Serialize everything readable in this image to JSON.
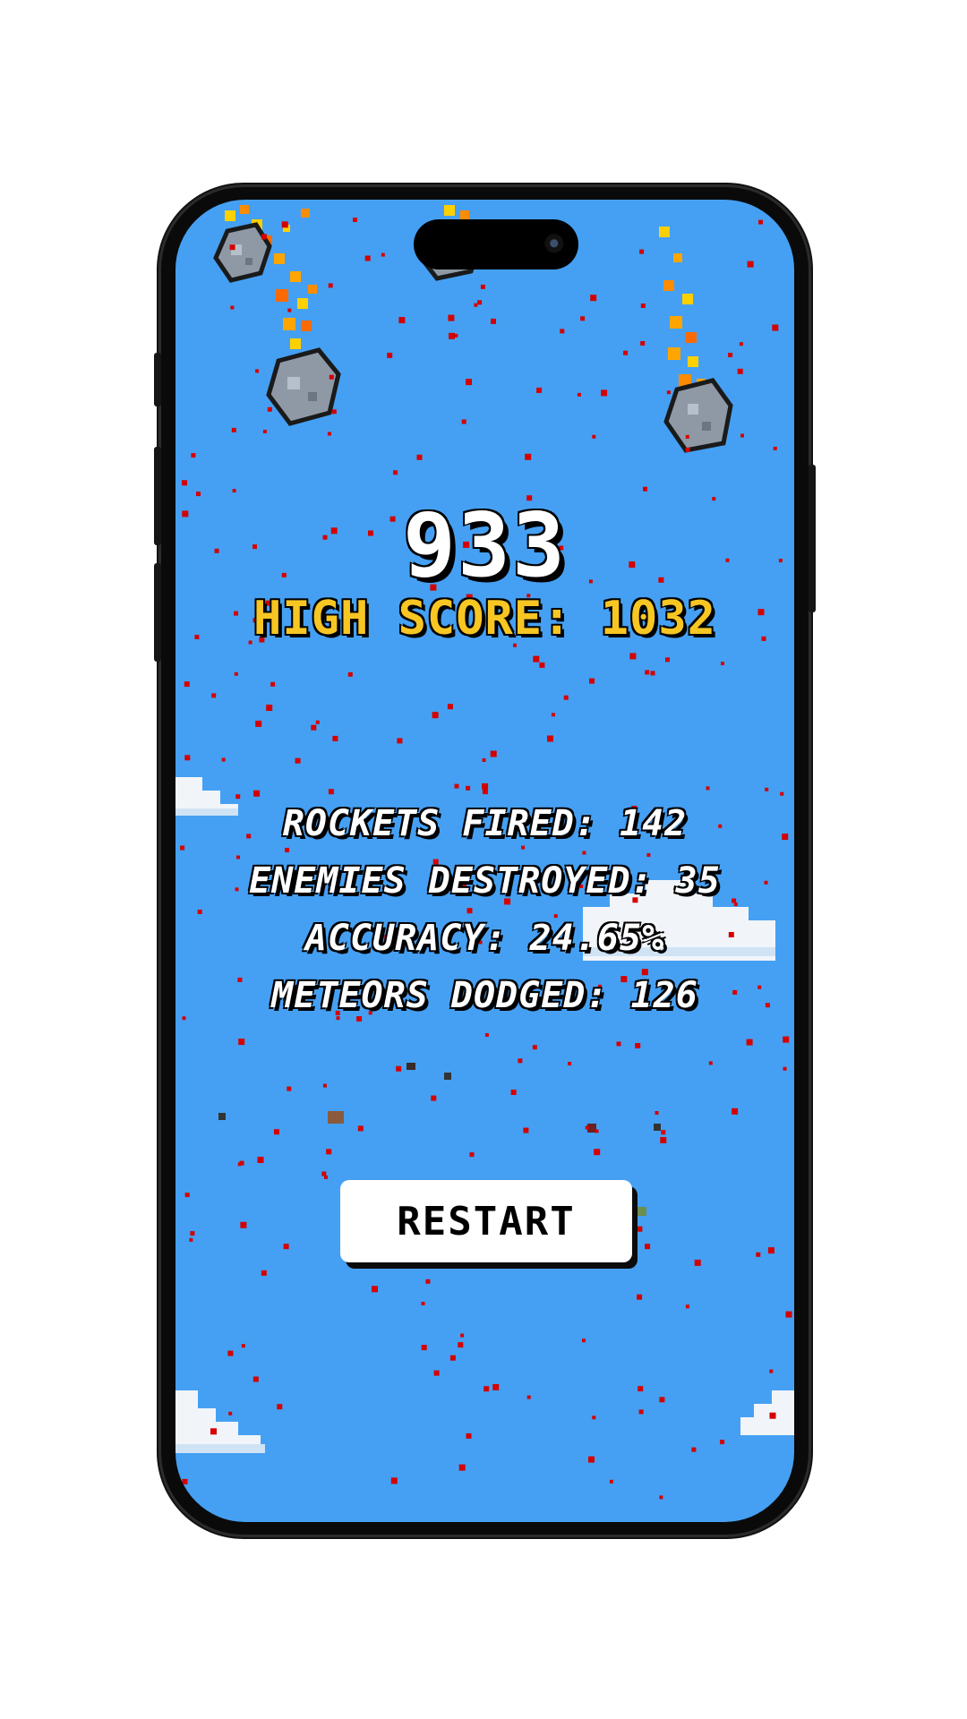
{
  "game": {
    "score": "933",
    "high_score": "HIGH SCORE: 1032",
    "stats": {
      "rockets_fired": "ROCKETS FIRED: 142",
      "enemies_destroyed": "ENEMIES DESTROYED: 35",
      "accuracy": "ACCURACY: 24.65%",
      "meteors_dodged": "METEORS DODGED: 126"
    },
    "restart_label": "RESTART"
  },
  "colors": {
    "sky": "#45a0f3",
    "score_text": "#ffffff",
    "high_score_text": "#f7c623",
    "particles": "#d40000",
    "meteor": "#8f99a6",
    "fire": "#ffa500"
  }
}
